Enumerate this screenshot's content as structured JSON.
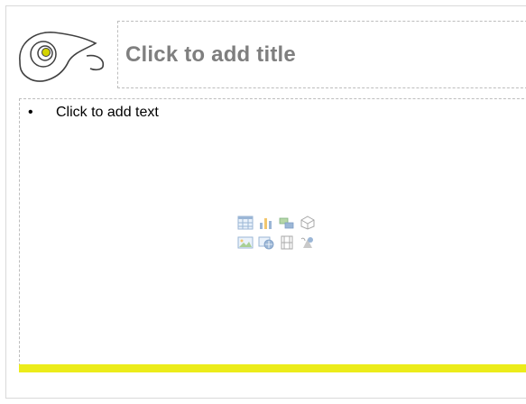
{
  "slide": {
    "title_placeholder": "Click to add title",
    "content_placeholder": {
      "bullet": "•",
      "text": "Click to add text"
    },
    "insert_icons": [
      {
        "icon": "table-icon"
      },
      {
        "icon": "chart-icon"
      },
      {
        "icon": "smartart-icon"
      },
      {
        "icon": "3d-model-icon"
      },
      {
        "icon": "picture-icon"
      },
      {
        "icon": "online-picture-icon"
      },
      {
        "icon": "video-icon"
      },
      {
        "icon": "icons-icon"
      }
    ],
    "colors": {
      "accent_bar": "#ecec1a",
      "logo_stroke": "#404040",
      "logo_dot": "#c8c800",
      "placeholder_border": "#bdbdbd",
      "title_text": "#7f7f7f"
    }
  }
}
